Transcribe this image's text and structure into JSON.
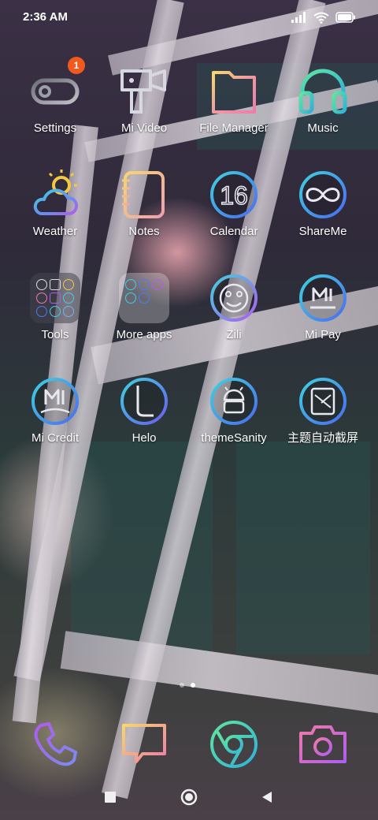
{
  "status_bar": {
    "time": "2:36 AM"
  },
  "apps": [
    {
      "label": "Settings",
      "icon": "settings-icon",
      "badge": "1"
    },
    {
      "label": "Mi Video",
      "icon": "video-camera-icon"
    },
    {
      "label": "File Manager",
      "icon": "folder-icon"
    },
    {
      "label": "Music",
      "icon": "headphones-icon"
    },
    {
      "label": "Weather",
      "icon": "weather-icon"
    },
    {
      "label": "Notes",
      "icon": "notebook-icon"
    },
    {
      "label": "Calendar",
      "icon": "calendar-icon",
      "icon_text": "16"
    },
    {
      "label": "ShareMe",
      "icon": "shareme-icon"
    },
    {
      "label": "Tools",
      "icon": "folder-tools-icon"
    },
    {
      "label": "More apps",
      "icon": "folder-more-apps-icon"
    },
    {
      "label": "Zili",
      "icon": "zili-icon"
    },
    {
      "label": "Mi Pay",
      "icon": "mi-pay-icon"
    },
    {
      "label": "Mi Credit",
      "icon": "mi-credit-icon"
    },
    {
      "label": "Helo",
      "icon": "helo-icon"
    },
    {
      "label": "themeSanity",
      "icon": "android-icon"
    },
    {
      "label": "主题自动截屏",
      "icon": "screenshot-icon"
    }
  ],
  "page_indicator": {
    "pages": 2,
    "current": 2
  },
  "dock": [
    "phone-icon",
    "message-icon",
    "chrome-icon",
    "camera-icon"
  ],
  "nav": [
    "recents-button",
    "home-button",
    "back-button"
  ],
  "colors": {
    "accent_cyan": "#3ed0e0",
    "accent_blue": "#4a7cf0",
    "accent_pink": "#f07aa8",
    "accent_yellow": "#f5d76e",
    "accent_purple": "#b05cf0",
    "badge": "#f05a1e"
  }
}
